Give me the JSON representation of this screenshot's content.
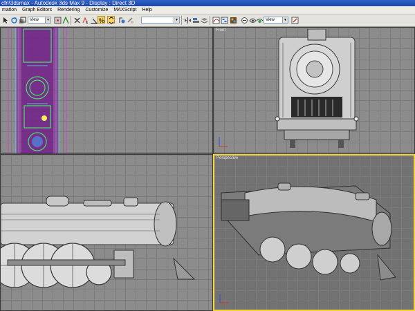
{
  "window": {
    "title": "cfn\\3dsmax      - Autodesk 3ds Max 9      - Display : Direct 3D"
  },
  "menu": [
    "mation",
    "Graph Editors",
    "Rendering",
    "Customize",
    "MAXScript",
    "Help"
  ],
  "toolbar": {
    "ref_coord": "View",
    "named_selection": "",
    "view_combo": "View",
    "icons": [
      "select-object-icon",
      "rotate-icon",
      "scale-icon",
      "snap-icon",
      "angle-snap-icon",
      "percent-snap-icon",
      "spinner-snap-icon",
      "named-selection-sets-icon",
      "mirror-icon",
      "align-icon",
      "layer-manager-icon",
      "curve-editor-icon",
      "schematic-view-icon",
      "material-editor-icon",
      "render-setup-icon",
      "quick-render-icon"
    ]
  },
  "viewports": {
    "top": {
      "label": ""
    },
    "front": {
      "label": "Front"
    },
    "left": {
      "label": ""
    },
    "perspective": {
      "label": "Perspective"
    }
  },
  "colors": {
    "active_border": "#f3d436",
    "viewport_bg": "#8c8c8c",
    "grid": "#7b7b7b"
  }
}
